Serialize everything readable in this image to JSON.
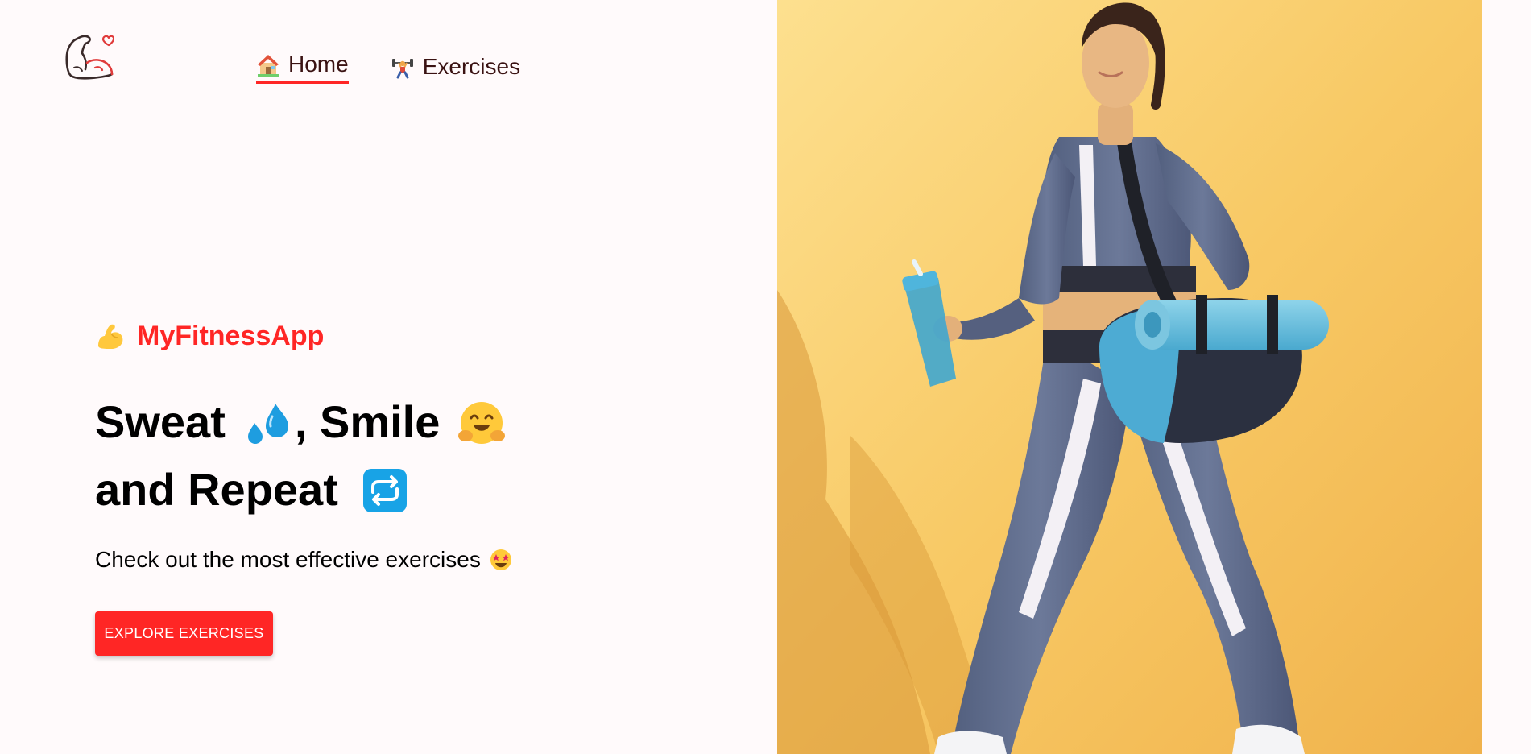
{
  "nav": {
    "logo_alt": "logo",
    "links": [
      {
        "label": "Home",
        "icon": "house-emoji-icon",
        "active": true
      },
      {
        "label": "Exercises",
        "icon": "weightlifter-emoji-icon",
        "active": false
      }
    ]
  },
  "hero": {
    "brand": "MyFitnessApp",
    "brand_icon": "flexed-biceps-icon",
    "headline_line1_a": "Sweat",
    "headline_line1_b": ", Smile",
    "headline_line2": "and Repeat",
    "subtitle": "Check out the most effective exercises",
    "cta_label": "EXPLORE EXERCISES",
    "image_alt": "banner"
  },
  "colors": {
    "accent": "#ff2625",
    "background": "#fffafb",
    "nav_text": "#3a1212",
    "hero_bg": "#f7c45c"
  }
}
